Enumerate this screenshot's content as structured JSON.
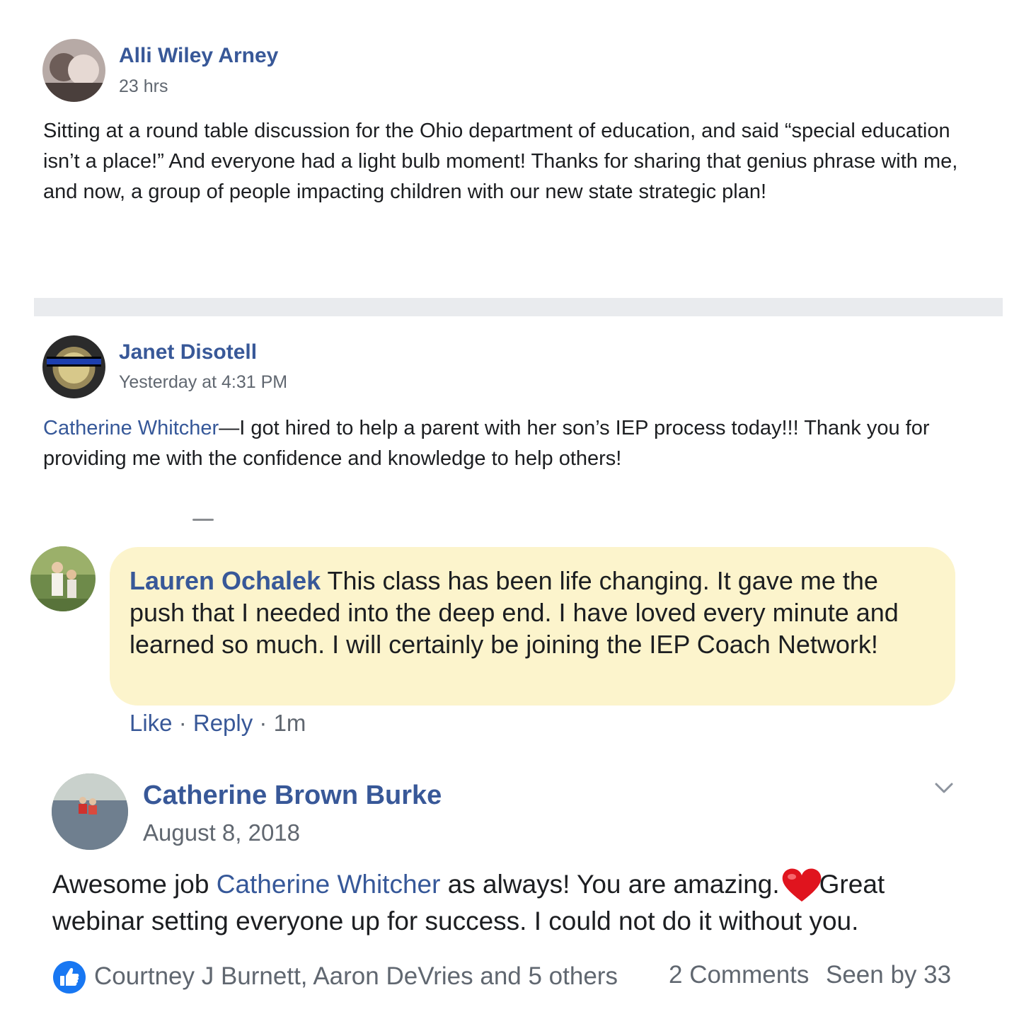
{
  "posts": [
    {
      "author": "Alli Wiley Arney",
      "timestamp": "23 hrs",
      "text": "Sitting at a round table discussion for the Ohio department of education, and said “special education isn’t a place!” And everyone had a light bulb moment! Thanks for sharing that genius phrase with me, and now, a group of people impacting children with our new state strategic plan!"
    },
    {
      "author": "Janet Disotell",
      "timestamp": "Yesterday at 4:31 PM",
      "mention": "Catherine Whitcher",
      "text": "—I got hired to help a parent with her son’s IEP process today!!! Thank you for providing me with the confidence and knowledge to help others!"
    }
  ],
  "comment": {
    "author": "Lauren Ochalek",
    "text": " This class has been life changing. It gave me the push that I needed into the deep end. I have loved every minute and learned so much. I will certainly be joining the IEP Coach Network!",
    "like_label": "Like",
    "reply_label": "Reply",
    "separator": " · ",
    "age": "1m"
  },
  "post3": {
    "author": "Catherine Brown Burke",
    "timestamp": "August 8, 2018",
    "text_before": "Awesome job ",
    "mention": "Catherine Whitcher",
    "text_middle": " as always! You are amazing.",
    "text_after": "Great webinar setting everyone up for success. I could not do it without you.",
    "reactions": "Courtney J Burnett, Aaron DeVries and 5 others",
    "comments": "2 Comments",
    "seen_by": "Seen by 33"
  },
  "icons": {
    "like": "thumbs-up-icon",
    "heart": "heart-emoji-icon",
    "chevron": "chevron-down-icon"
  },
  "colors": {
    "link": "#365899",
    "comment_bubble": "#fcf4cc",
    "separator": "#e9ebee",
    "like_blue": "#1877f2",
    "heart_red": "#e0141e"
  }
}
